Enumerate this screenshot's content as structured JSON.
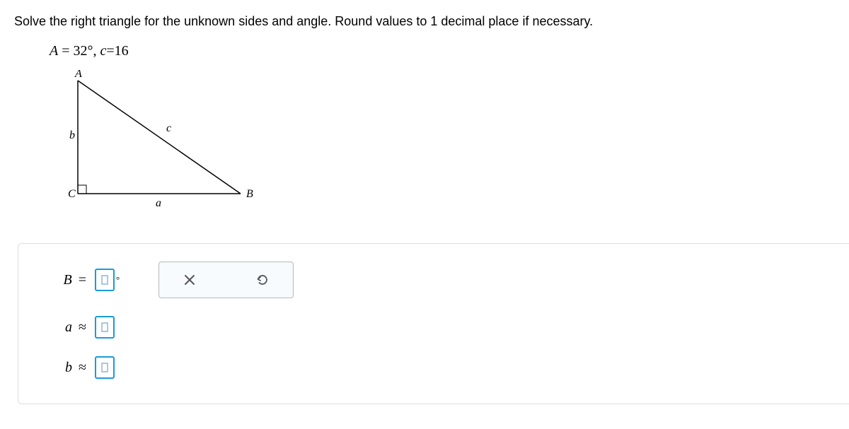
{
  "question": "Solve the right triangle for the unknown sides and angle. Round values to 1 decimal place if necessary.",
  "given": {
    "angle_var": "A",
    "angle_eq": " = ",
    "angle_val": "32",
    "deg": "°",
    "sep": ", ",
    "side_var": "c",
    "side_eq": "=",
    "side_val": "16"
  },
  "triangle": {
    "vertex_A": "A",
    "vertex_B": "B",
    "vertex_C": "C",
    "side_a": "a",
    "side_b": "b",
    "side_c": "c"
  },
  "answers": {
    "B": {
      "var": "B",
      "op": "=",
      "value": "",
      "deg": "°"
    },
    "a": {
      "var": "a",
      "op": "≈",
      "value": ""
    },
    "b": {
      "var": "b",
      "op": "≈",
      "value": ""
    }
  },
  "tools": {
    "clear": "clear",
    "undo": "undo"
  }
}
